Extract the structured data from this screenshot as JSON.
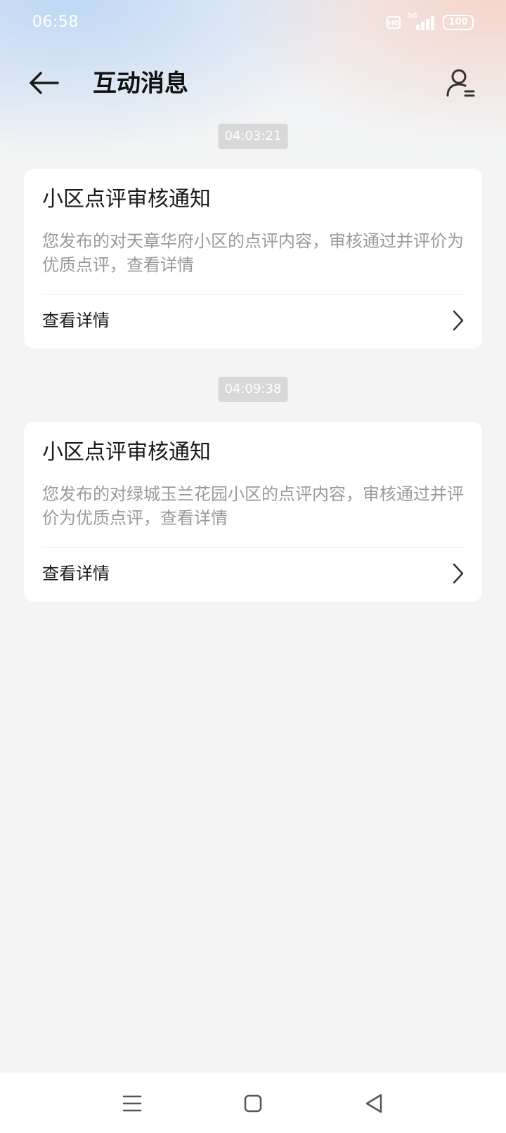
{
  "status_bar": {
    "time": "06:58",
    "hd": "HD",
    "network": "5G",
    "battery": "100"
  },
  "header": {
    "title": "互动消息",
    "back_icon": "arrow-left-icon",
    "profile_icon": "user-settings-icon"
  },
  "messages": [
    {
      "time": "04:03:21",
      "title": "小区点评审核通知",
      "body": "您发布的对天章华府小区的点评内容，审核通过并评价为优质点评，查看详情",
      "link_label": "查看详情"
    },
    {
      "time": "04:09:38",
      "title": "小区点评审核通知",
      "body": "您发布的对绿城玉兰花园小区的点评内容，审核通过并评价为优质点评，查看详情",
      "link_label": "查看详情"
    }
  ],
  "nav_bar": {
    "menu_icon": "menu-icon",
    "home_icon": "home-square-icon",
    "back_icon": "back-triangle-icon"
  },
  "colors": {
    "background": "#f4f4f4",
    "card": "#ffffff",
    "time_badge": "#d8d8d8",
    "body_text": "#9a9a9a"
  }
}
